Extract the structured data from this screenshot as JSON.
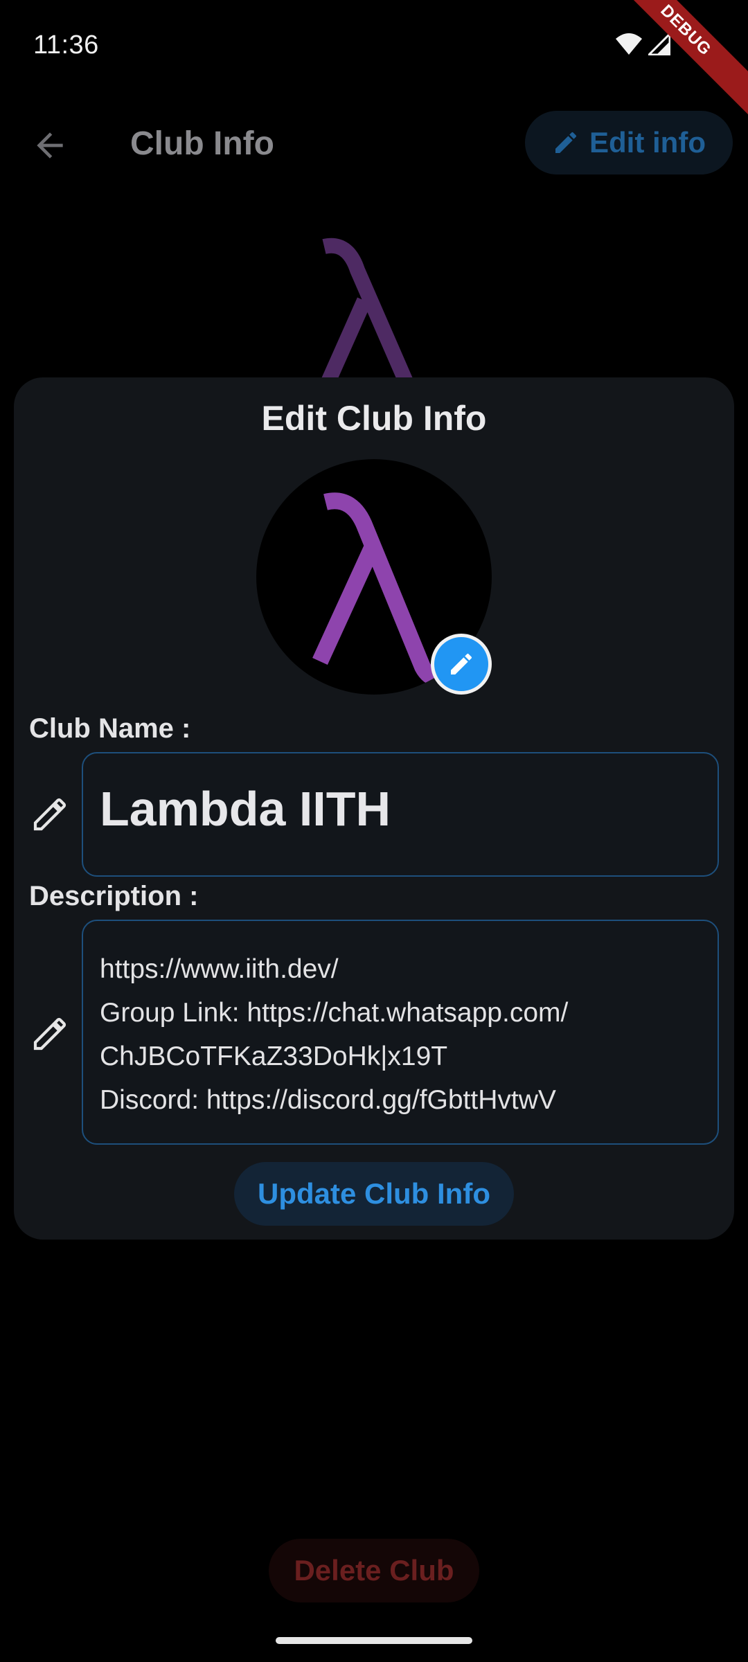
{
  "status_bar": {
    "time": "11:36",
    "icons": [
      "wifi-icon",
      "signal-icon"
    ],
    "debug_banner": "DEBUG"
  },
  "app_bar": {
    "title": "Club Info",
    "back_icon": "arrow-back-icon",
    "edit_button": {
      "icon": "pencil-icon",
      "label": "Edit info"
    }
  },
  "sheet": {
    "title": "Edit Club Info",
    "avatar": {
      "glyph": "λ",
      "edit_icon": "pencil-icon"
    },
    "name_field": {
      "label": "Club Name :",
      "value": "Lambda IITH",
      "icon": "pencil-icon"
    },
    "description_field": {
      "label": "Description :",
      "icon": "pencil-icon",
      "lines": [
        "https://www.iith.dev/",
        "Group Link: https://chat.whatsapp.com/",
        "ChJBCoTFKaZ33DoHk|x19T",
        "Discord: https://discord.gg/fGbttHvtwV"
      ]
    },
    "update_button": "Update Club Info"
  },
  "delete_button": "Delete Club",
  "colors": {
    "background": "#000000",
    "sheet": "#13161a",
    "accent_blue": "#2196f3",
    "logo_purple": "#8e44ad",
    "delete_red": "#6a1f1f",
    "field_border": "#1d4f7c"
  }
}
